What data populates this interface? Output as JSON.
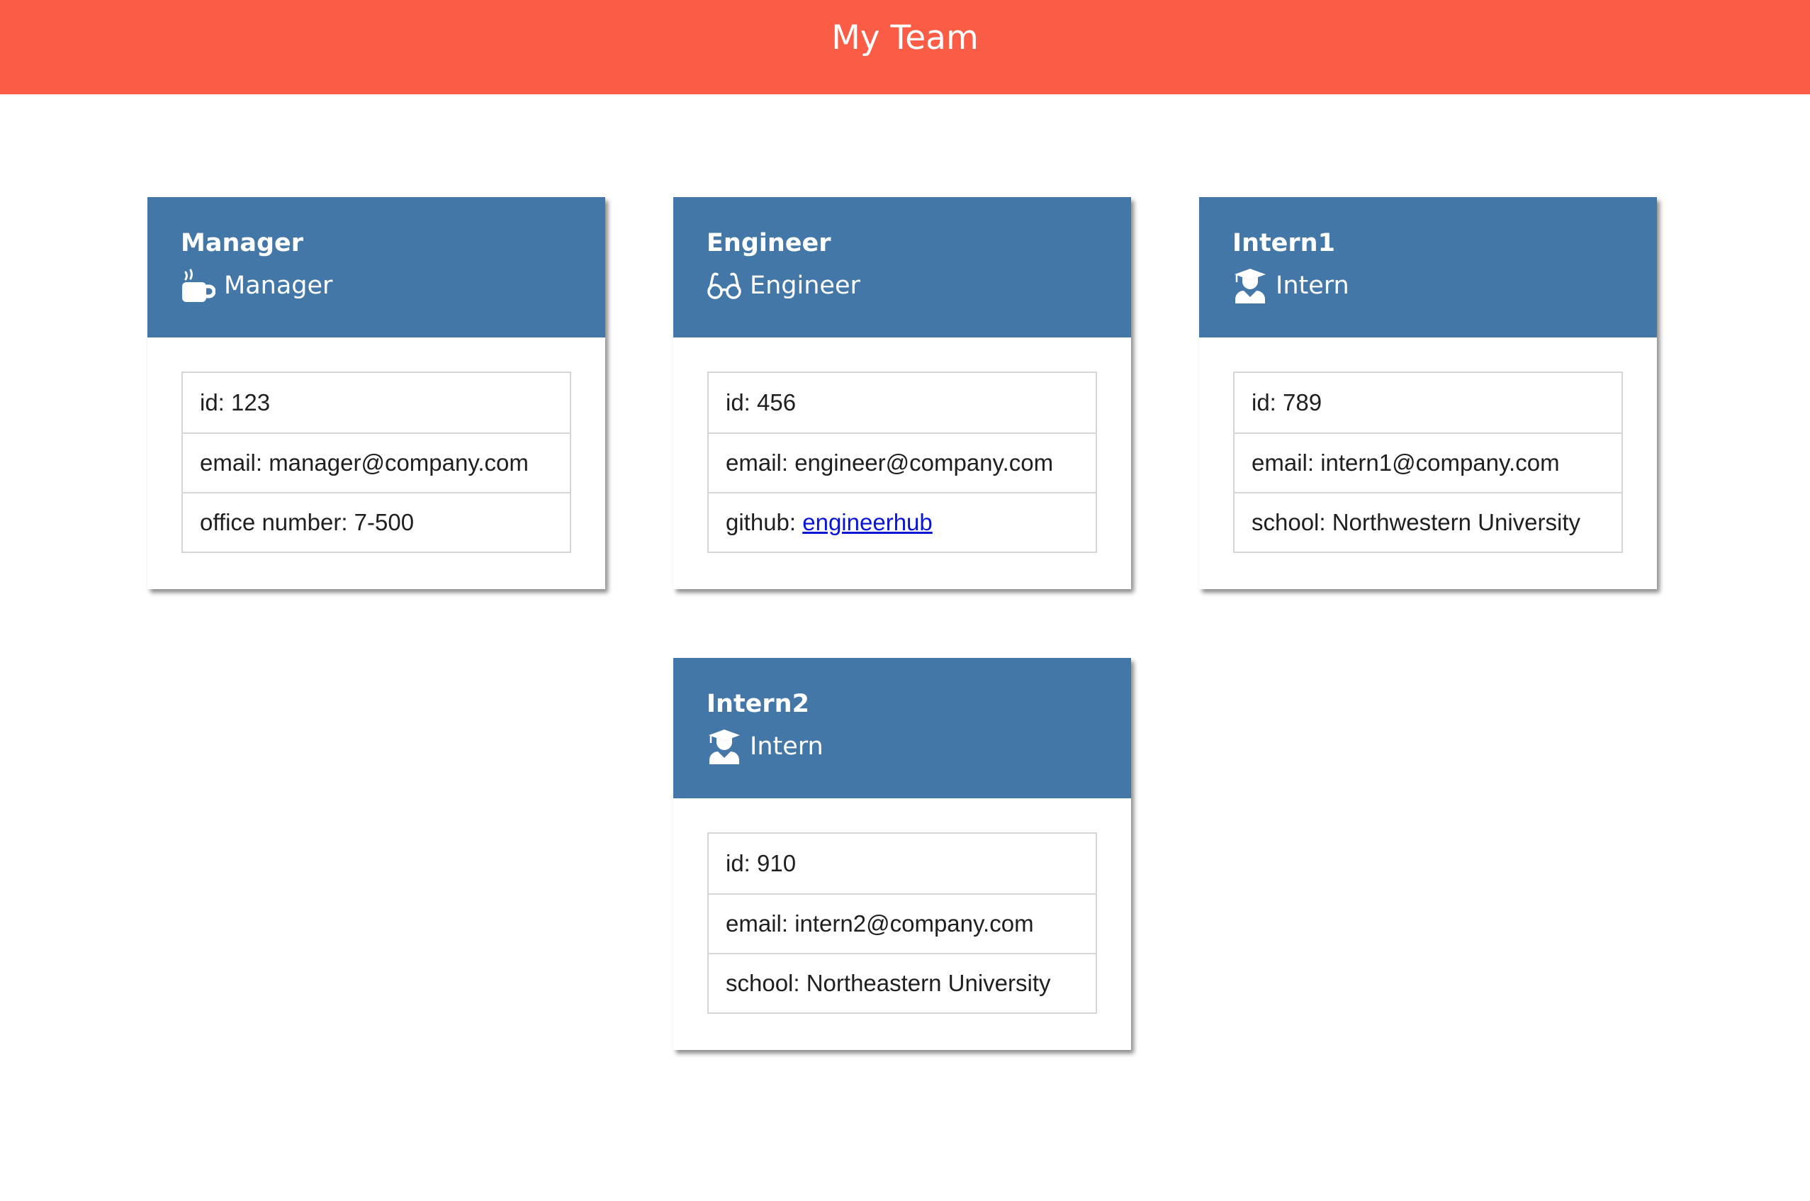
{
  "header": {
    "title": "My Team",
    "background": "#fb5c46"
  },
  "colors": {
    "card_header": "#4277a8",
    "link": "#0a14d6"
  },
  "cards": [
    {
      "name": "Manager",
      "role": "Manager",
      "icon": "coffee-mug-icon",
      "id_text": "id: 123",
      "email_text": "email: manager@company.com",
      "extra_text": "office number: 7-500"
    },
    {
      "name": "Engineer",
      "role": "Engineer",
      "icon": "glasses-icon",
      "id_text": "id: 456",
      "email_text": "email: engineer@company.com",
      "extra_label": "github: ",
      "extra_link": "engineerhub"
    },
    {
      "name": "Intern1",
      "role": "Intern",
      "icon": "graduate-icon",
      "id_text": "id: 789",
      "email_text": "email: intern1@company.com",
      "extra_text": "school: Northwestern University"
    },
    {
      "name": "Intern2",
      "role": "Intern",
      "icon": "graduate-icon",
      "id_text": "id: 910",
      "email_text": "email: intern2@company.com",
      "extra_text": "school: Northeastern University"
    }
  ]
}
